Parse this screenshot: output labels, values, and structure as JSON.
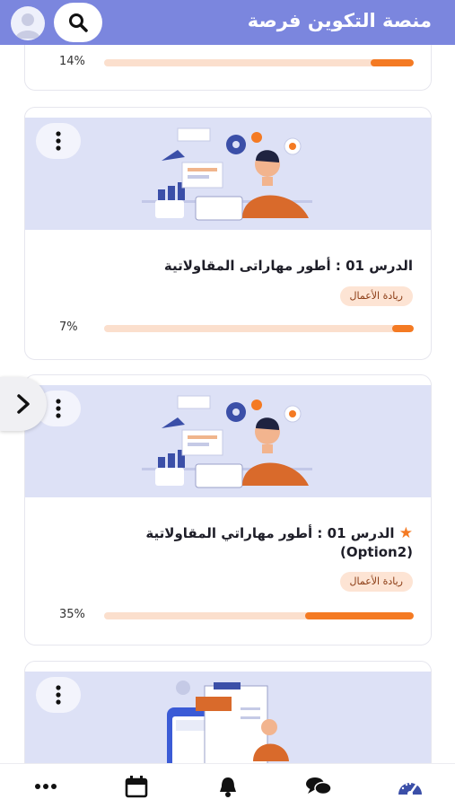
{
  "header": {
    "title": "منصة التكوين فرصة",
    "avatar_icon": "user-avatar-icon",
    "search_icon": "search-icon"
  },
  "top_card": {
    "progress_text": "14%",
    "progress": 0.14
  },
  "courses": [
    {
      "title": "الدرس 01 : أطور مهاراتى المقاولاتية",
      "tag": "ريادة الأعمال",
      "progress_text": "7%",
      "progress": 0.07,
      "starred": false
    },
    {
      "title": "الدرس 01 : أطور مهاراتي المقاولاتية (Option2)",
      "tag": "ريادة الأعمال",
      "progress_text": "35%",
      "progress": 0.35,
      "starred": true
    }
  ],
  "bottom_nav": [
    "more-icon",
    "calendar-icon",
    "bell-icon",
    "chat-icon",
    "dashboard-gauge-icon"
  ],
  "colors": {
    "header": "#7b86de",
    "accent": "#f47a23",
    "track": "#fbdfcd",
    "image_bg": "#dde1f6",
    "tag_bg": "#fde4d4"
  }
}
